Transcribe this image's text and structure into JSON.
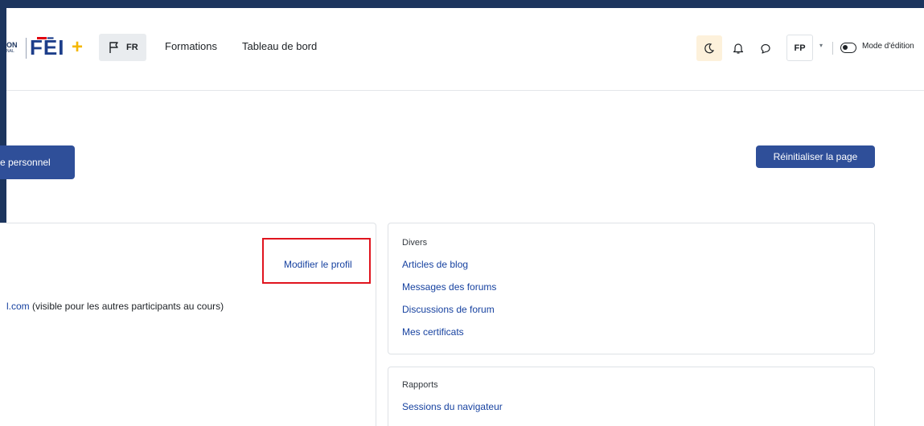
{
  "header": {
    "logo_fragment_top": "ON",
    "logo_fragment_bottom": "NAL",
    "logo_text": "FĒI",
    "logo_plus": "+",
    "language": "FR",
    "nav_links": [
      "Formations",
      "Tableau de bord"
    ],
    "user_initials": "FP",
    "edit_mode_label": "Mode d'édition"
  },
  "page": {
    "profile_button_label": "e personnel",
    "reset_button_label": "Réinitialiser la page"
  },
  "profile_card": {
    "edit_profile_link": "Modifier le profil",
    "email_fragment": "l.com",
    "email_note": " (visible pour les autres participants au cours)"
  },
  "divers": {
    "title": "Divers",
    "links": [
      "Articles de blog",
      "Messages des forums",
      "Discussions de forum",
      "Mes certificats"
    ]
  },
  "rapports": {
    "title": "Rapports",
    "links": [
      "Sessions du navigateur"
    ]
  },
  "colors": {
    "frame": "#1c355e",
    "primary_button": "#2f4f99",
    "link": "#1742a0",
    "highlight": "#e0141e",
    "brand_plus": "#f5b700"
  },
  "icons": [
    "flag-icon",
    "moon-icon",
    "bell-icon",
    "chat-icon",
    "chevron-down-icon",
    "toggle-icon"
  ]
}
